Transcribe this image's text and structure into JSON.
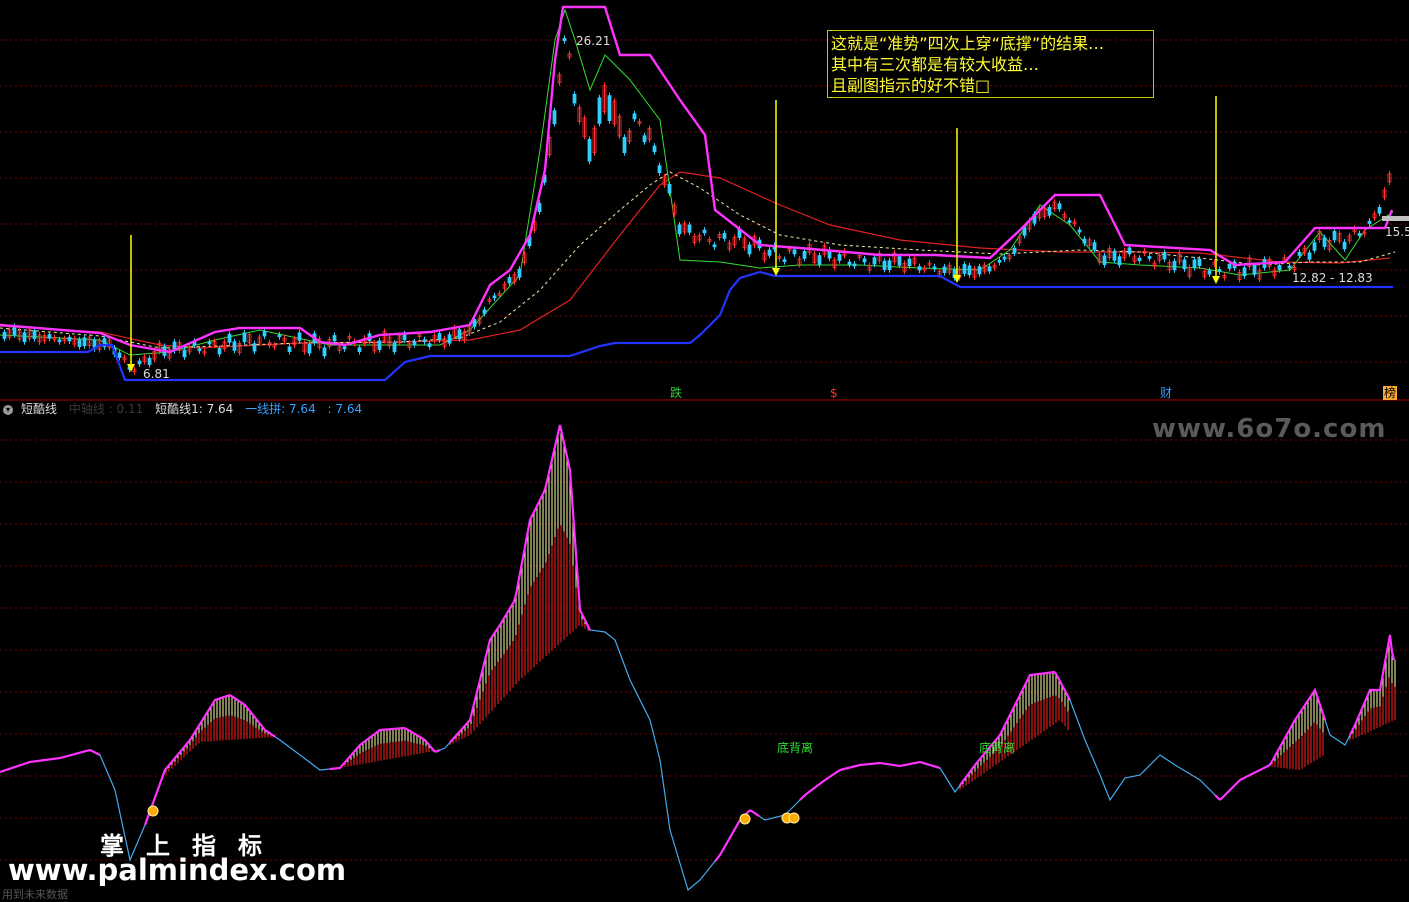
{
  "main_panel": {
    "annotation_lines": [
      "这就是“准势”四次上穿“底撑”的结果…",
      "其中有三次都是有较大收益…",
      "且副图指示的好不错□"
    ],
    "price_high_label": "26.21",
    "price_low_label": "6.81",
    "range_label": "12.82 - 12.83",
    "right_price_label": "15.5",
    "signal_labels": [
      "跌",
      "$",
      "财",
      "榜"
    ]
  },
  "sub_panel": {
    "indicator_name": "短酷线",
    "legend_items": [
      {
        "text": "中轴线 : 0.11",
        "color": "#3a3a3a"
      },
      {
        "text": "短酷线1: 7.64",
        "color": "#dddddd"
      },
      {
        "text": "一线拼: 7.64",
        "color": "#3aa0ff"
      },
      {
        "text": ": 7.64",
        "color": "#3aa0ff"
      }
    ],
    "divergence_labels": [
      "底背离",
      "底背离"
    ]
  },
  "watermarks": {
    "site": "www.6o7o.com",
    "brand_cn": "掌上指标",
    "brand_url": "www.palmindex.com"
  },
  "footer_text": "用到未来数据",
  "colors": {
    "background": "#000000",
    "grid": "#7a0000",
    "bb_upper": "#ff33ff",
    "bb_lower": "#2233ff",
    "ma_long": "#e02020",
    "ma_white": "#ffffff",
    "ma_green": "#33dd33",
    "arrow": "#ffff00",
    "candle_up": "#ff3333",
    "candle_down": "#33ccff",
    "sub_line": "#44aaee",
    "sub_hist_red": "#c01818",
    "sub_hist_yellow": "#ffffaa"
  }
}
